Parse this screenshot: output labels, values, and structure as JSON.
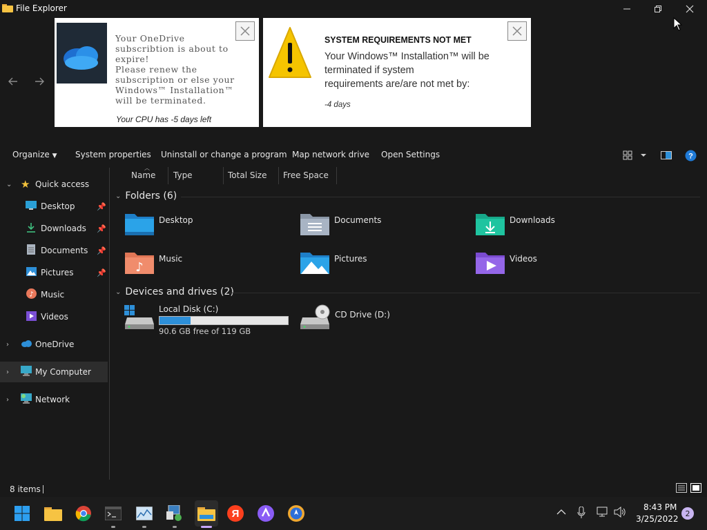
{
  "window": {
    "title": "File Explorer"
  },
  "popups": {
    "onedrive": {
      "text": "Your OneDrive\nsubscribtion is about to\nexpire!\nPlease renew the\nsubscription or else your\nWindows™ Installation™\nwill be terminated.",
      "footer": "Your CPU has -5 days left"
    },
    "sysreq": {
      "title": "SYSTEM REQUIREMENTS NOT MET",
      "text": "Your Windows™ Installation™ will be\nterminated if system\nrequirements are/are not met by:",
      "footer": "-4 days"
    }
  },
  "commandbar": {
    "organize": "Organize",
    "system_properties": "System properties",
    "uninstall": "Uninstall or change a program",
    "map_drive": "Map network drive",
    "open_settings": "Open Settings"
  },
  "columns": [
    "Name",
    "Type",
    "Total Size",
    "Free Space"
  ],
  "sidebar": {
    "quick_access": "Quick access",
    "items": [
      "Desktop",
      "Downloads",
      "Documents",
      "Pictures",
      "Music",
      "Videos"
    ],
    "onedrive": "OneDrive",
    "my_computer": "My Computer",
    "network": "Network"
  },
  "folders": {
    "header": "Folders (6)",
    "items": [
      "Desktop",
      "Documents",
      "Downloads",
      "Music",
      "Pictures",
      "Videos"
    ]
  },
  "drives": {
    "header": "Devices and drives (2)",
    "local": {
      "name": "Local Disk (C:)",
      "free_text": "90.6 GB free of 119 GB",
      "used_fraction": 0.24
    },
    "cd": {
      "name": "CD Drive (D:)"
    }
  },
  "status": {
    "items": "8 items"
  },
  "taskbar": {
    "time": "8:43 PM",
    "date": "3/25/2022",
    "notifications": "2"
  },
  "colors": {
    "accent": "#2d8fd8",
    "background": "#191919",
    "warning": "#f5c400"
  }
}
